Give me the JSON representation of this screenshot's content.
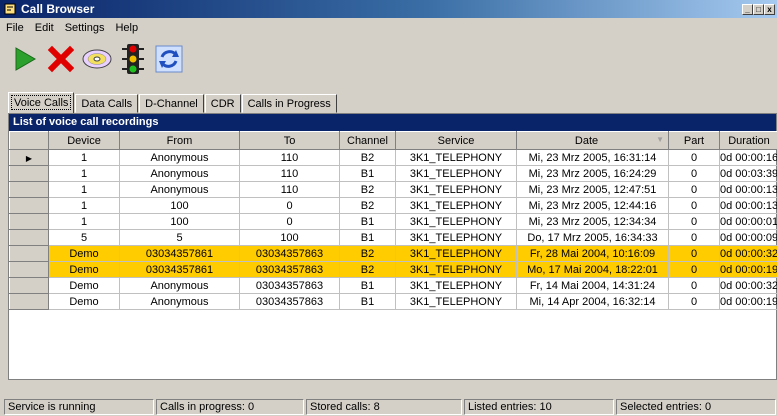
{
  "window": {
    "title": "Call Browser"
  },
  "menu": {
    "file": "File",
    "edit": "Edit",
    "settings": "Settings",
    "help": "Help"
  },
  "toolbar": {
    "icons": [
      "play-icon",
      "stop-icon",
      "disc-icon",
      "traffic-light-icon",
      "refresh-icon"
    ]
  },
  "tabs": [
    "Voice Calls",
    "Data Calls",
    "D-Channel",
    "CDR",
    "Calls in Progress"
  ],
  "panel": {
    "title": "List of voice call recordings"
  },
  "table": {
    "columns": [
      "Device",
      "From",
      "To",
      "Channel",
      "Service",
      "Date",
      "Part",
      "Duration"
    ],
    "rows": [
      [
        "1",
        "Anonymous",
        "110",
        "B2",
        "3K1_TELEPHONY",
        "Mi, 23 Mrz 2005, 16:31:14",
        "0",
        "0d 00:00:16"
      ],
      [
        "1",
        "Anonymous",
        "110",
        "B1",
        "3K1_TELEPHONY",
        "Mi, 23 Mrz 2005, 16:24:29",
        "0",
        "0d 00:03:39"
      ],
      [
        "1",
        "Anonymous",
        "110",
        "B2",
        "3K1_TELEPHONY",
        "Mi, 23 Mrz 2005, 12:47:51",
        "0",
        "0d 00:00:13"
      ],
      [
        "1",
        "100",
        "0",
        "B2",
        "3K1_TELEPHONY",
        "Mi, 23 Mrz 2005, 12:44:16",
        "0",
        "0d 00:00:13"
      ],
      [
        "1",
        "100",
        "0",
        "B1",
        "3K1_TELEPHONY",
        "Mi, 23 Mrz 2005, 12:34:34",
        "0",
        "0d 00:00:01"
      ],
      [
        "5",
        "5",
        "100",
        "B1",
        "3K1_TELEPHONY",
        "Do, 17 Mrz 2005, 16:34:33",
        "0",
        "0d 00:00:09"
      ],
      [
        "Demo",
        "03034357861",
        "03034357863",
        "B2",
        "3K1_TELEPHONY",
        "Fr, 28 Mai 2004, 10:16:09",
        "0",
        "0d 00:00:32"
      ],
      [
        "Demo",
        "03034357861",
        "03034357863",
        "B2",
        "3K1_TELEPHONY",
        "Mo, 17 Mai 2004, 18:22:01",
        "0",
        "0d 00:00:19"
      ],
      [
        "Demo",
        "Anonymous",
        "03034357863",
        "B1",
        "3K1_TELEPHONY",
        "Fr, 14 Mai 2004, 14:31:24",
        "0",
        "0d 00:00:32"
      ],
      [
        "Demo",
        "Anonymous",
        "03034357863",
        "B1",
        "3K1_TELEPHONY",
        "Mi, 14 Apr 2004, 16:32:14",
        "0",
        "0d 00:00:19"
      ]
    ],
    "highlighted_rows": [
      6,
      7
    ],
    "highlight_color": "#ffcc00"
  },
  "status": {
    "service": "Service is running",
    "in_progress": "Calls in progress: 0",
    "stored": "Stored calls: 8",
    "listed": "Listed entries: 10",
    "selected": "Selected entries: 0"
  }
}
